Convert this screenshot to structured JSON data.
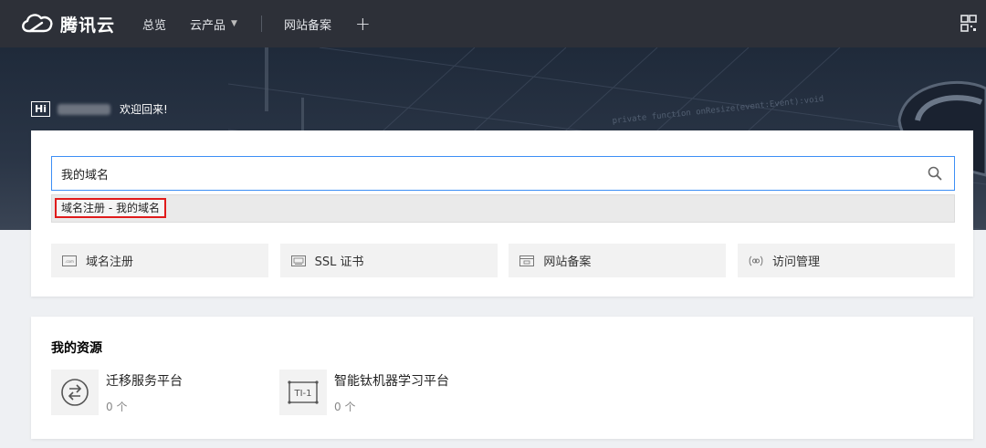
{
  "brand": {
    "name": "腾讯云"
  },
  "nav": {
    "items": [
      {
        "label": "总览"
      },
      {
        "label": "云产品"
      },
      {
        "label": "网站备案"
      }
    ],
    "plus": "+"
  },
  "hero": {
    "hi": "Hi",
    "welcome": "欢迎回来!",
    "code_lines": [
      "private function onResize(event:Event):void"
    ]
  },
  "search": {
    "value": "我的域名",
    "suggestion": "域名注册 - 我的域名"
  },
  "quick_links": [
    {
      "label": "域名注册",
      "icon": "domain-icon"
    },
    {
      "label": "SSL 证书",
      "icon": "ssl-icon"
    },
    {
      "label": "网站备案",
      "icon": "filing-icon"
    },
    {
      "label": "访问管理",
      "icon": "access-icon"
    }
  ],
  "resources": {
    "title": "我的资源",
    "items": [
      {
        "name": "迁移服务平台",
        "count": "0 个",
        "icon": "migrate-icon"
      },
      {
        "name": "智能钛机器学习平台",
        "count": "0 个",
        "icon": "ti-icon"
      }
    ]
  },
  "colors": {
    "topbar": "#2d3038",
    "accent": "#3d8ff5",
    "highlight": "#e01b1b"
  }
}
